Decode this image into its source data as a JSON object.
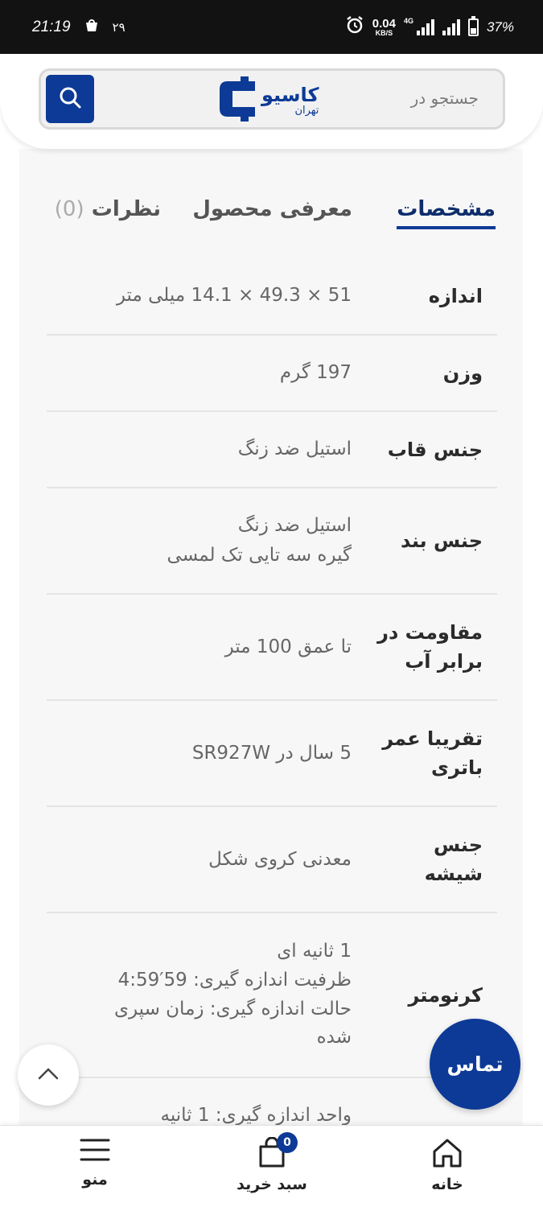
{
  "status_bar": {
    "time": "21:19",
    "notification_text": "۲۹",
    "net_speed_value": "0.04",
    "net_speed_unit": "KB/S",
    "network_type": "4G",
    "battery": "37%",
    "battery_level": 0.37
  },
  "header": {
    "search_placeholder": "جستجو در",
    "logo_main": "کاسیو",
    "logo_sub": "تهران"
  },
  "tabs": [
    {
      "label": "مشخصات",
      "active": true
    },
    {
      "label": "معرفی محصول",
      "active": false
    },
    {
      "label": "نظرات",
      "count": "(0)",
      "active": false
    }
  ],
  "specs": [
    {
      "label": "اندازه",
      "values": [
        "51 × 49.3 × 14.1 میلی متر"
      ]
    },
    {
      "label": "وزن",
      "values": [
        "197 گرم"
      ]
    },
    {
      "label": "جنس قاب",
      "values": [
        "استیل ضد زنگ"
      ]
    },
    {
      "label": "جنس بند",
      "values": [
        "استیل ضد زنگ",
        "گیره سه تایی تک لمسی"
      ]
    },
    {
      "label": "مقاومت در برابر آب",
      "values": [
        "تا عمق 100 متر"
      ]
    },
    {
      "label": "تقریبا عمر باتری",
      "values": [
        "5 سال در SR927W"
      ]
    },
    {
      "label": "جنس شیشه",
      "values": [
        "معدنی کروی شکل"
      ]
    },
    {
      "label": "کرنومتر",
      "values": [
        "1 ثانیه ای",
        "ظرفیت اندازه گیری: 59′4:59",
        "حالت اندازه گیری: زمان سپری",
        "شده"
      ]
    },
    {
      "label": "",
      "values": [
        "واحد اندازه گیری: 1 ثانیه"
      ]
    }
  ],
  "floating": {
    "contact_label": "تماس",
    "scroll_top_icon": "chevron-up-icon"
  },
  "bottom_nav": {
    "menu_label": "منو",
    "cart_label": "سبد خرید",
    "cart_count": "0",
    "home_label": "خانه"
  },
  "colors": {
    "brand": "#0d3a96",
    "status_bar": "#121212"
  }
}
